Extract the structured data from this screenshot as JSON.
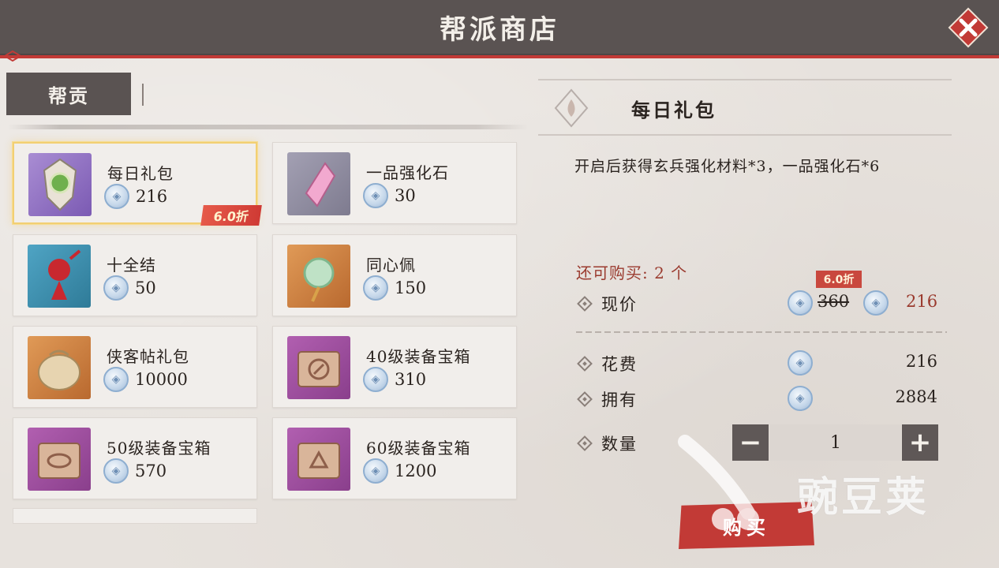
{
  "header": {
    "title": "帮派商店"
  },
  "tab": {
    "label": "帮贡"
  },
  "items": [
    {
      "name": "每日礼包",
      "price": "216",
      "discount": "6.0折",
      "selected": true
    },
    {
      "name": "一品强化石",
      "price": "30"
    },
    {
      "name": "十全结",
      "price": "50"
    },
    {
      "name": "同心佩",
      "price": "150"
    },
    {
      "name": "侠客帖礼包",
      "price": "10000"
    },
    {
      "name": "40级装备宝箱",
      "price": "310"
    },
    {
      "name": "50级装备宝箱",
      "price": "570"
    },
    {
      "name": "60级装备宝箱",
      "price": "1200"
    }
  ],
  "detail": {
    "title": "每日礼包",
    "description": "开启后获得玄兵强化材料*3，一品强化石*6",
    "remaining": "还可购买: 2 个",
    "price_label": "现价",
    "discount": "6.0折",
    "old_price": "360",
    "new_price": "216",
    "cost_label": "花费",
    "cost_value": "216",
    "own_label": "拥有",
    "own_value": "2884",
    "qty_label": "数量",
    "qty_value": "1",
    "minus": "−",
    "plus": "+",
    "buy_label": "购买"
  },
  "watermark": {
    "text": "豌豆荚"
  },
  "colors": {
    "header_bg": "#5a5352",
    "accent_red": "#c23a36",
    "selected_border": "#f2cf73",
    "coin_blue": "#8eaed0"
  },
  "icons": {
    "close": "close-x-icon",
    "coin": "guild-coin-icon"
  }
}
